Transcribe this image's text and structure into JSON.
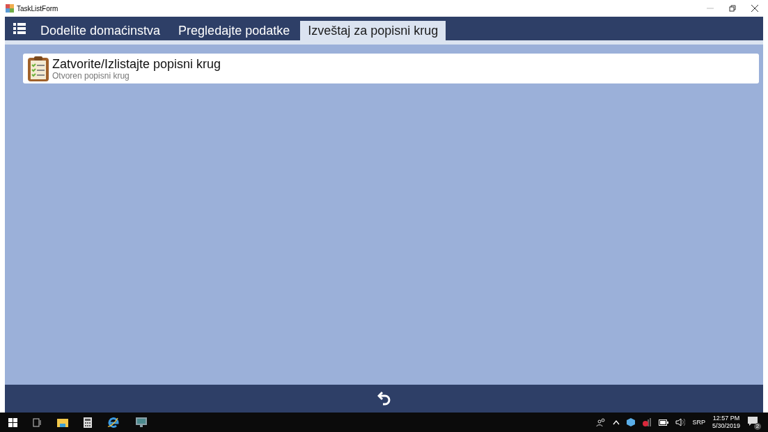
{
  "window": {
    "title": "TaskListForm"
  },
  "tabs": [
    {
      "label": "Dodelite domaćinstva",
      "selected": false
    },
    {
      "label": "Pregledajte podatke",
      "selected": false
    },
    {
      "label": "Izveštaj za popisni krug",
      "selected": true
    }
  ],
  "tasks": [
    {
      "title": "Zatvorite/Izlistajte popisni krug",
      "subtitle": "Otvoren popisni krug"
    }
  ],
  "taskbar": {
    "language": "SRP",
    "time": "12:57 PM",
    "date": "5/30/2019",
    "notification_count": "2"
  }
}
